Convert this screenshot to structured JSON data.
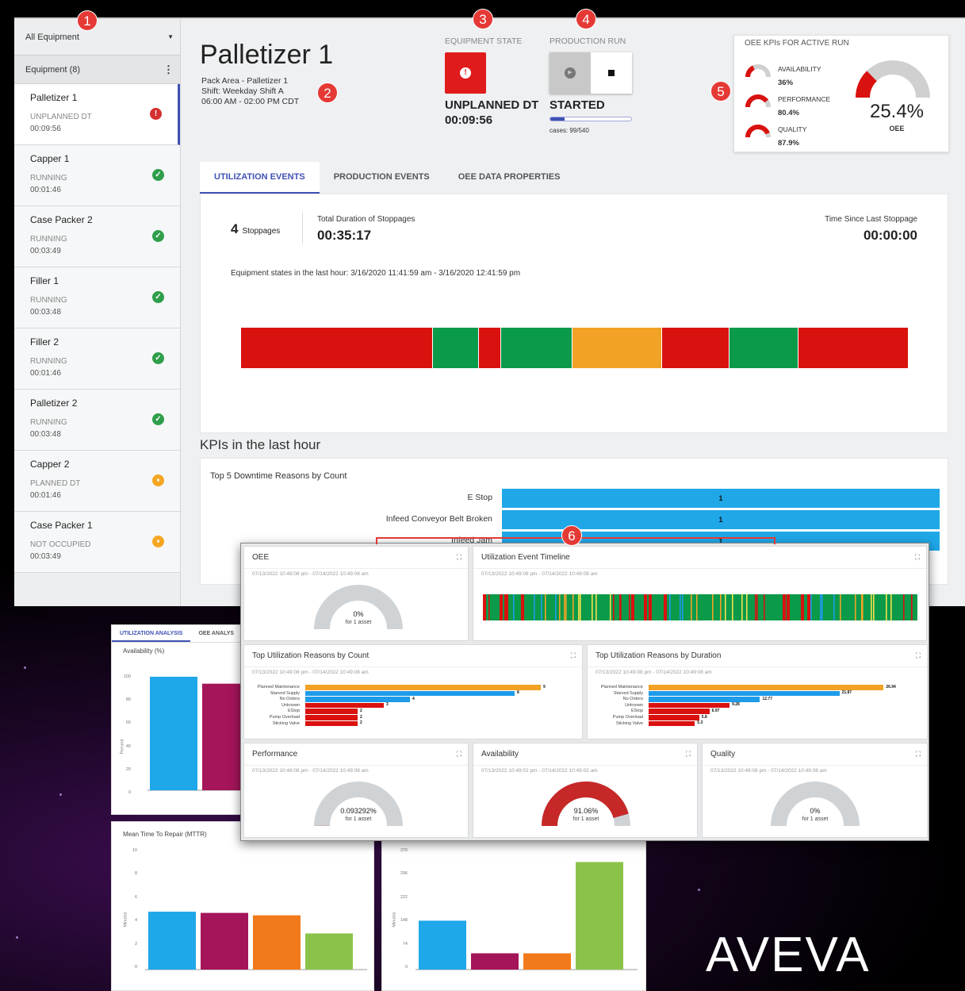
{
  "markers": {
    "m1": "1",
    "m2": "2",
    "m3": "3",
    "m4": "4",
    "m5": "5",
    "m6": "6"
  },
  "sidebar": {
    "filter": "All Equipment",
    "header": "Equipment (8)",
    "items": [
      {
        "name": "Palletizer 1",
        "state": "UNPLANNED DT",
        "time": "00:09:56",
        "status": "error"
      },
      {
        "name": "Capper 1",
        "state": "RUNNING",
        "time": "00:01:46",
        "status": "ok"
      },
      {
        "name": "Case Packer 2",
        "state": "RUNNING",
        "time": "00:03:49",
        "status": "ok"
      },
      {
        "name": "Filler 1",
        "state": "RUNNING",
        "time": "00:03:48",
        "status": "ok"
      },
      {
        "name": "Filler 2",
        "state": "RUNNING",
        "time": "00:01:46",
        "status": "ok"
      },
      {
        "name": "Palletizer 2",
        "state": "RUNNING",
        "time": "00:03:48",
        "status": "ok"
      },
      {
        "name": "Capper 2",
        "state": "PLANNED DT",
        "time": "00:01:46",
        "status": "paused"
      },
      {
        "name": "Case Packer 1",
        "state": "NOT OCCUPIED",
        "time": "00:03:49",
        "status": "paused"
      }
    ]
  },
  "header": {
    "title": "Palletizer 1",
    "line1": "Pack Area - Palletizer 1",
    "line2": "Shift: Weekday Shift A",
    "line3": "06:00 AM - 02:00 PM CDT",
    "equipment_state_label": "EQUIPMENT STATE",
    "equipment_state": "UNPLANNED DT",
    "equipment_state_time": "00:09:56",
    "production_run_label": "PRODUCTION RUN",
    "production_run_state": "STARTED",
    "cases": "cases: 99/540",
    "cases_progress": 0.18
  },
  "kpis": {
    "title": "OEE KPIs FOR ACTIVE RUN",
    "availability_label": "AVAILABILITY",
    "availability": "36%",
    "availability_frac": 0.36,
    "performance_label": "PERFORMANCE",
    "performance": "80.4%",
    "performance_frac": 0.804,
    "quality_label": "QUALITY",
    "quality": "87.9%",
    "quality_frac": 0.879,
    "oee": "25.4%",
    "oee_label": "OEE",
    "oee_frac": 0.254
  },
  "tabs": [
    "UTILIZATION EVENTS",
    "PRODUCTION EVENTS",
    "OEE DATA PROPERTIES"
  ],
  "util": {
    "stoppages_count": "4",
    "stoppages_label": "Stoppages",
    "duration_label": "Total Duration of Stoppages",
    "duration": "00:35:17",
    "since_label": "Time Since Last Stoppage",
    "since": "00:00:00",
    "range_text": "Equipment states in the last hour: 3/16/2020 11:41:59 am - 3/16/2020 12:41:59 pm",
    "segments": [
      {
        "state": "down",
        "frac": 0.288
      },
      {
        "state": "running",
        "frac": 0.068
      },
      {
        "state": "down",
        "frac": 0.033
      },
      {
        "state": "running",
        "frac": 0.107
      },
      {
        "state": "planned",
        "frac": 0.135
      },
      {
        "state": "down",
        "frac": 0.101
      },
      {
        "state": "running",
        "frac": 0.103
      },
      {
        "state": "down",
        "frac": 0.165
      }
    ],
    "colors": {
      "down": "#d9120f",
      "running": "#0b9a4a",
      "planned": "#f2a227"
    }
  },
  "kpi_section": {
    "title": "KPIs in the last hour",
    "chart_title": "Top 5 Downtime Reasons by Count",
    "rows": [
      {
        "label": "E Stop",
        "value": "1"
      },
      {
        "label": "Infeed Conveyor Belt Broken",
        "value": "1"
      },
      {
        "label": "Infeed Jam",
        "value": "1"
      }
    ]
  },
  "overlay": {
    "oee": {
      "title": "OEE",
      "date": "07/13/2022 10:49:08 pm - 07/14/2022 10:49:08 am",
      "value": "0%",
      "sub": "for 1 asset",
      "frac": 0
    },
    "timeline": {
      "title": "Utilization Event Timeline",
      "date": "07/13/2022 10:49:08 pm - 07/14/2022 10:49:08 am"
    },
    "by_count": {
      "title": "Top Utilization Reasons by Count",
      "date": "07/13/2022 10:49:08 pm - 07/14/2022 10:49:08 am",
      "rows": [
        {
          "label": "Planned Maintenance",
          "value": 9,
          "text": "9",
          "color": "#f2a227"
        },
        {
          "label": "Starved Supply",
          "value": 8,
          "text": "8",
          "color": "#1e9be9"
        },
        {
          "label": "No Orders",
          "value": 4,
          "text": "4",
          "color": "#1e9be9"
        },
        {
          "label": "Unknown",
          "value": 3,
          "text": "3",
          "color": "#d9120f"
        },
        {
          "label": "EStop",
          "value": 2,
          "text": "2",
          "color": "#d9120f"
        },
        {
          "label": "Pump Overload",
          "value": 2,
          "text": "2",
          "color": "#d9120f"
        },
        {
          "label": "Sticking Valve",
          "value": 2,
          "text": "2",
          "color": "#d9120f"
        }
      ]
    },
    "by_duration": {
      "title": "Top Utilization Reasons by Duration",
      "date": "07/13/2022 10:49:08 pm - 07/14/2022 10:49:08 am",
      "rows": [
        {
          "label": "Planned Maintenance",
          "value": 26.94,
          "text": "26.94",
          "color": "#f2a227"
        },
        {
          "label": "Starved Supply",
          "value": 21.87,
          "text": "21.87",
          "color": "#1e9be9"
        },
        {
          "label": "No Orders",
          "value": 12.77,
          "text": "12.77",
          "color": "#1e9be9"
        },
        {
          "label": "Unknown",
          "value": 9.28,
          "text": "9.28",
          "color": "#d9120f"
        },
        {
          "label": "EStop",
          "value": 6.97,
          "text": "6.97",
          "color": "#d9120f"
        },
        {
          "label": "Pump Overload",
          "value": 5.8,
          "text": "5.8",
          "color": "#d9120f"
        },
        {
          "label": "Sticking Valve",
          "value": 5.3,
          "text": "5.3",
          "color": "#d9120f"
        }
      ]
    },
    "performance": {
      "title": "Performance",
      "date": "07/13/2022 10:49:08 pm - 07/14/2022 10:49:08 am",
      "value": "0.093292%",
      "sub": "for 1 asset",
      "frac": 0.001
    },
    "availability": {
      "title": "Availability",
      "date": "07/13/2022 10:49:02 pm - 07/14/2022 10:49:02 am",
      "value": "91.06%",
      "sub": "for 1 asset",
      "frac": 0.9106
    },
    "quality": {
      "title": "Quality",
      "date": "07/13/2022 10:49:08 pm - 07/14/2022 10:49:08 am",
      "value": "0%",
      "sub": "for 1 asset",
      "frac": 0
    }
  },
  "back": {
    "tab1": "UTILIZATION ANALYSIS",
    "tab2": "OEE ANALYS",
    "avail_title": "Availability (%)",
    "avail_ylabel": "Percent",
    "avail_ticks": [
      "100",
      "80",
      "60",
      "40",
      "20",
      "0"
    ],
    "mttr_title": "Mean Time To Repair (MTTR)",
    "mttr_ylabel": "Minutes",
    "mttr_ticks": [
      "10",
      "8",
      "6",
      "4",
      "2",
      "0"
    ],
    "right_ylabel": "Minutes",
    "right_ticks": [
      "370",
      "296",
      "222",
      "148",
      "74",
      "0"
    ]
  },
  "chart_data": [
    {
      "type": "bar",
      "title": "Top 5 Downtime Reasons by Count",
      "categories": [
        "E Stop",
        "Infeed Conveyor Belt Broken",
        "Infeed Jam"
      ],
      "values": [
        1,
        1,
        1
      ]
    },
    {
      "type": "bar",
      "title": "Top Utilization Reasons by Count",
      "categories": [
        "Planned Maintenance",
        "Starved Supply",
        "No Orders",
        "Unknown",
        "EStop",
        "Pump Overload",
        "Sticking Valve"
      ],
      "values": [
        9,
        8,
        4,
        3,
        2,
        2,
        2
      ]
    },
    {
      "type": "bar",
      "title": "Top Utilization Reasons by Duration",
      "categories": [
        "Planned Maintenance",
        "Starved Supply",
        "No Orders",
        "Unknown",
        "EStop",
        "Pump Overload",
        "Sticking Valve"
      ],
      "values": [
        26.94,
        21.87,
        12.77,
        9.28,
        6.97,
        5.8,
        5.3
      ]
    },
    {
      "type": "bar",
      "title": "Availability (%)",
      "ylabel": "Percent",
      "ylim": [
        0,
        100
      ],
      "values": [
        98,
        92
      ],
      "colors": [
        "#1ea7e9",
        "#a4155a"
      ]
    },
    {
      "type": "bar",
      "title": "Mean Time To Repair (MTTR)",
      "ylabel": "Minutes",
      "ylim": [
        0,
        10
      ],
      "values": [
        4.8,
        4.7,
        4.5,
        3.0
      ],
      "colors": [
        "#1ea7e9",
        "#a4155a",
        "#f27a1b",
        "#8bc34a"
      ]
    },
    {
      "type": "bar",
      "ylabel": "Minutes",
      "ylim": [
        0,
        370
      ],
      "values": [
        150,
        50,
        50,
        330
      ],
      "colors": [
        "#1ea7e9",
        "#a4155a",
        "#f27a1b",
        "#8bc34a"
      ]
    }
  ],
  "brand": {
    "logo": "AVEVA"
  }
}
